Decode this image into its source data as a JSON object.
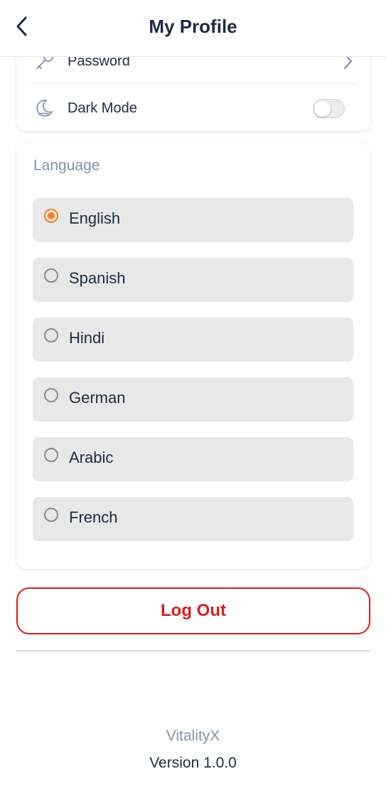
{
  "header": {
    "title": "My Profile",
    "back_icon": "chevron-left-icon"
  },
  "settings": {
    "password": {
      "label": "Password",
      "icon": "key-icon"
    },
    "dark_mode": {
      "label": "Dark Mode",
      "icon": "moon-icon",
      "enabled": false
    }
  },
  "language": {
    "title": "Language",
    "selected": "English",
    "options": [
      {
        "label": "English",
        "selected": true
      },
      {
        "label": "Spanish",
        "selected": false
      },
      {
        "label": "Hindi",
        "selected": false
      },
      {
        "label": "German",
        "selected": false
      },
      {
        "label": "Arabic",
        "selected": false
      },
      {
        "label": "French",
        "selected": false
      }
    ]
  },
  "logout": {
    "label": "Log Out"
  },
  "footer": {
    "app_name": "VitalityX",
    "version": "Version 1.0.0"
  },
  "colors": {
    "accent": "#f58220",
    "danger": "#d81e1e",
    "text": "#1f2a44",
    "muted": "#8093ad"
  }
}
